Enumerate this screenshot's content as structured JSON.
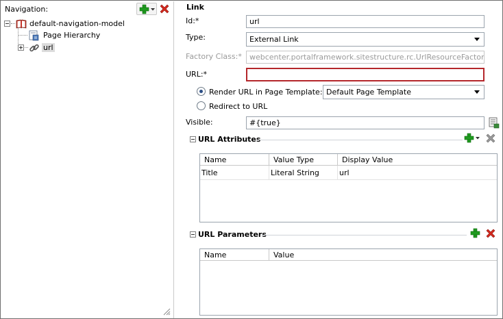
{
  "navigation": {
    "label": "Navigation:",
    "add_icon": "add-icon",
    "delete_icon": "delete-icon",
    "tree": [
      {
        "label": "default-navigation-model",
        "icon": "book-icon",
        "expanded": true
      },
      {
        "label": "Page Hierarchy",
        "icon": "page-hierarchy-icon"
      },
      {
        "label": "url",
        "icon": "link-icon",
        "selected": true,
        "expandable": true
      }
    ]
  },
  "link": {
    "section_title": "Link",
    "id": {
      "label": "Id:*",
      "value": "url"
    },
    "type": {
      "label": "Type:",
      "value": "External Link"
    },
    "factory_class": {
      "label": "Factory Class:*",
      "value": "webcenter.portalframework.sitestructure.rc.UrlResourceFactory"
    },
    "url": {
      "label": "URL:*",
      "value": ""
    },
    "render_option": {
      "label": "Render URL in Page Template:",
      "selected": true
    },
    "page_template": {
      "value": "Default Page Template"
    },
    "redirect_option": {
      "label": "Redirect to URL",
      "selected": false
    },
    "visible": {
      "label": "Visible:",
      "value": "#{true}"
    }
  },
  "url_attributes": {
    "title": "URL Attributes",
    "columns": [
      "Name",
      "Value Type",
      "Display Value"
    ],
    "rows": [
      [
        "Title",
        "Literal String",
        "url"
      ]
    ]
  },
  "url_parameters": {
    "title": "URL Parameters",
    "columns": [
      "Name",
      "Value"
    ],
    "rows": []
  },
  "colors": {
    "add_green": "#1f9a1f",
    "delete_red": "#d42a1e",
    "error_border": "#b4262a"
  }
}
